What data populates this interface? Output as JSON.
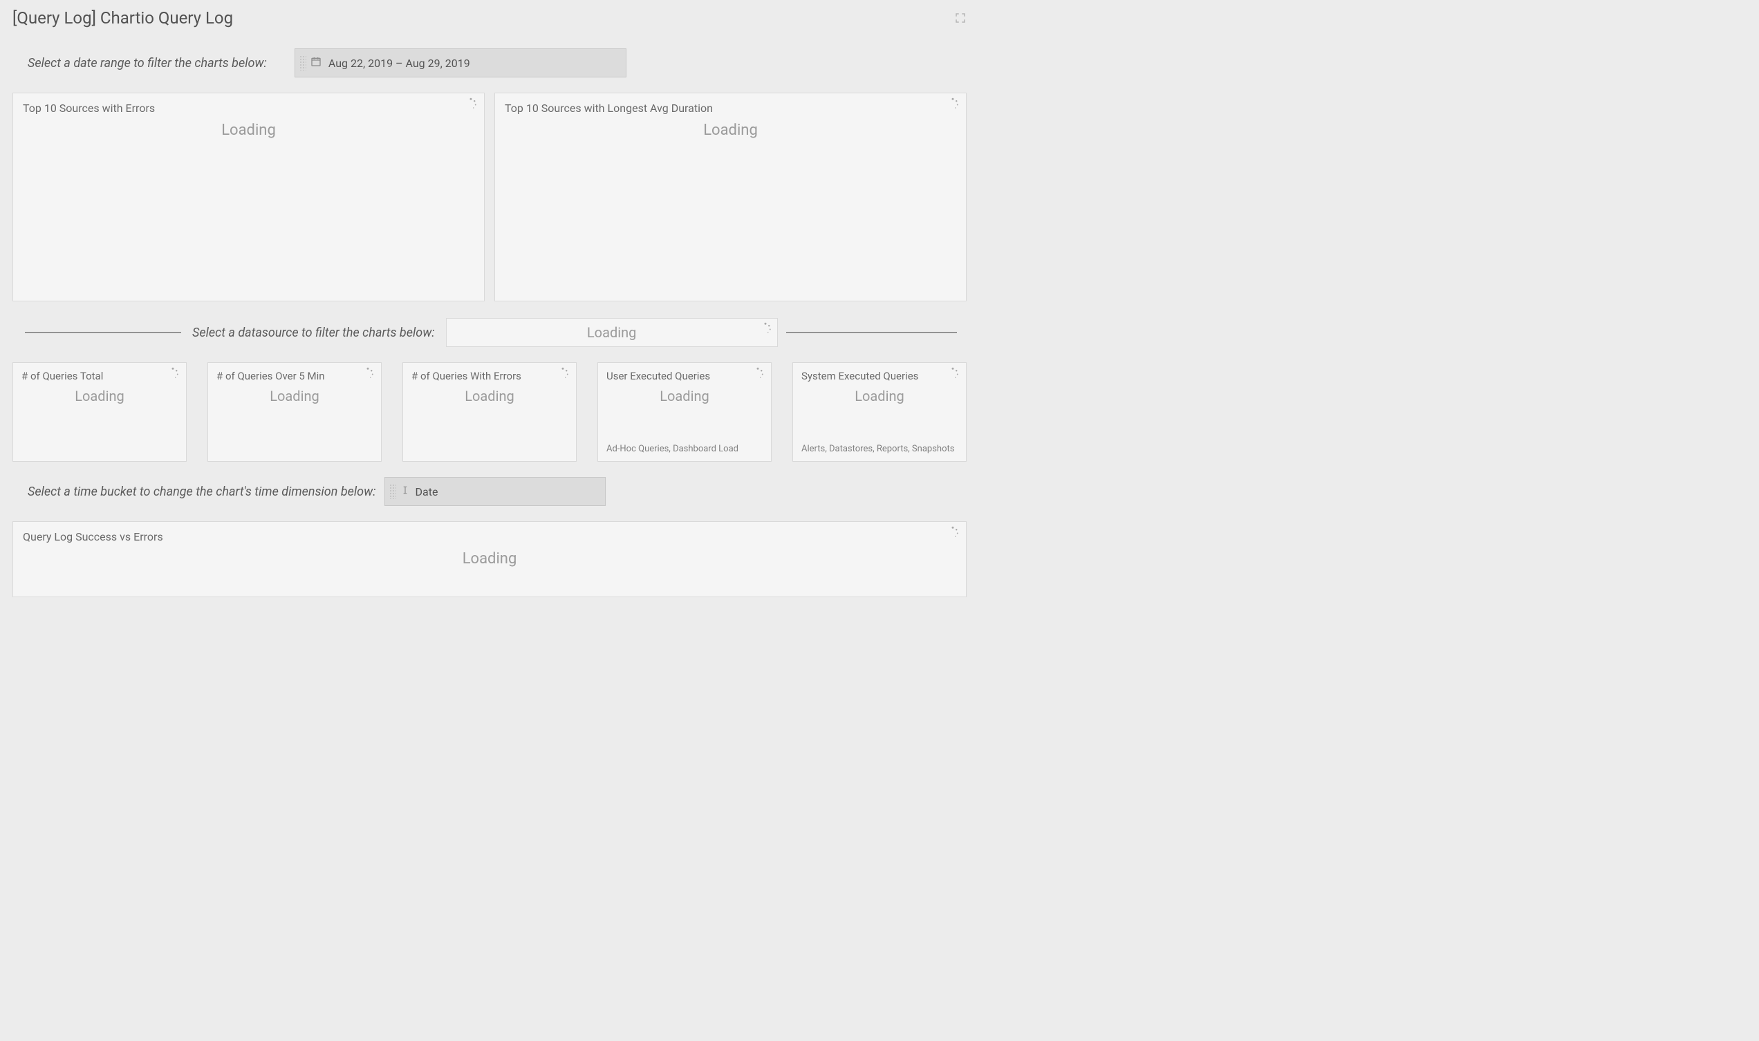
{
  "header": {
    "title": "[Query Log] Chartio Query Log"
  },
  "filters": {
    "date_range_label": "Select a date range to filter the charts below:",
    "date_range_value": "Aug 22, 2019  –  Aug 29, 2019",
    "datasource_label": "Select a datasource to filter the charts below:",
    "datasource_loading": "Loading",
    "timebucket_label": "Select a time bucket to change the chart's time dimension below:",
    "timebucket_value": "Date"
  },
  "loading_text": "Loading",
  "panels": {
    "top_left": {
      "title": "Top 10 Sources with Errors"
    },
    "top_right": {
      "title": "Top 10 Sources with Longest Avg Duration"
    },
    "small": [
      {
        "title": "# of Queries Total",
        "footer": ""
      },
      {
        "title": "# of Queries Over 5 Min",
        "footer": ""
      },
      {
        "title": "# of Queries With Errors",
        "footer": ""
      },
      {
        "title": "User Executed Queries",
        "footer": "Ad-Hoc Queries, Dashboard Load"
      },
      {
        "title": "System Executed Queries",
        "footer": "Alerts, Datastores, Reports, Snapshots"
      }
    ],
    "bottom": {
      "title": "Query Log Success vs Errors"
    }
  }
}
